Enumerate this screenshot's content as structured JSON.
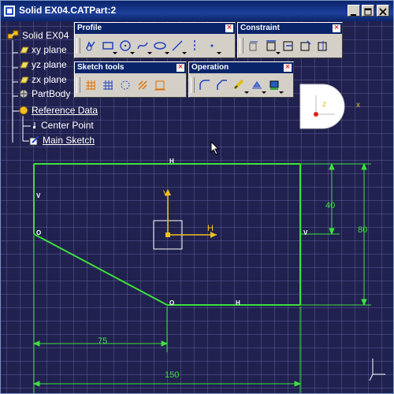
{
  "window": {
    "title": "Solid EX04.CATPart:2"
  },
  "tree": {
    "root": "Solid EX04",
    "items": [
      {
        "label": "xy plane"
      },
      {
        "label": "yz plane"
      },
      {
        "label": "zx plane"
      },
      {
        "label": "PartBody"
      },
      {
        "label": "Reference Data"
      },
      {
        "label": "Center Point"
      },
      {
        "label": "Main Sketch"
      }
    ]
  },
  "toolbars": {
    "profile": {
      "title": "Profile"
    },
    "constraint": {
      "title": "Constraint"
    },
    "sketch_tools": {
      "title": "Sketch tools"
    },
    "operation": {
      "title": "Operation"
    },
    "close_glyph": "×"
  },
  "sketch": {
    "dimensions": {
      "height_40": "40",
      "height_80": "80",
      "width_75": "75",
      "width_150": "150"
    },
    "constraint_marks": {
      "horizontal": "H",
      "vertical": "V",
      "coincident": "O"
    },
    "axis_labels": {
      "h": "H",
      "v": "V"
    }
  },
  "compass": {
    "z_label": "z",
    "x_label": "x"
  },
  "colors": {
    "sketch": "#3ce03c",
    "axis": "#f0c020",
    "background": "#21214f",
    "titlebar": "#0a246a"
  }
}
